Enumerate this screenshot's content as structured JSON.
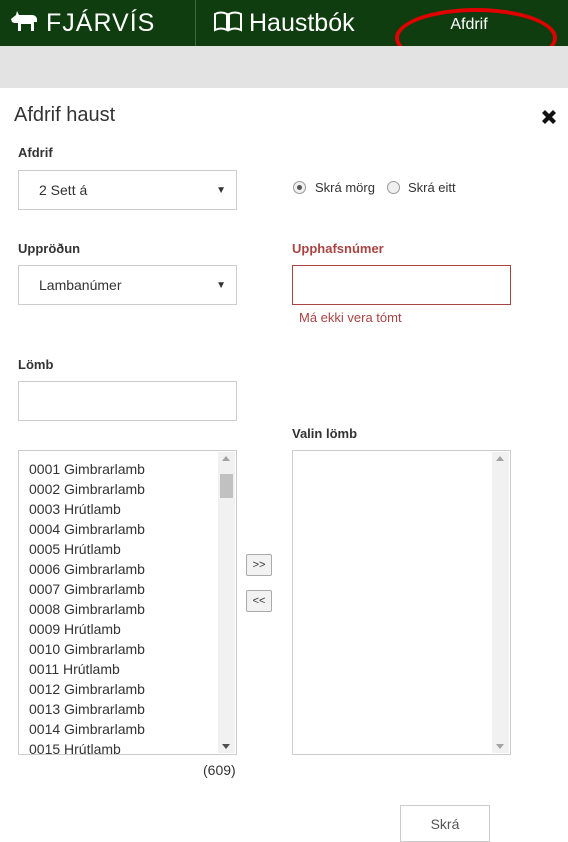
{
  "header": {
    "brand": "FJÁRVÍS",
    "book": "Haustbók",
    "active_tab": "Afdrif"
  },
  "modal": {
    "title": "Afdrif haust",
    "afdrif_label": "Afdrif",
    "afdrif_value": "2 Sett á",
    "radio_many": "Skrá mörg",
    "radio_one": "Skrá eitt",
    "sort_label": "Uppröðun",
    "sort_value": "Lambanúmer",
    "start_label": "Upphafsnúmer",
    "start_value": "",
    "start_error": "Má ekki vera tómt",
    "lambs_label": "Lömb",
    "lambs_filter_value": "",
    "selected_label": "Valin lömb",
    "lambs": [
      "0001 Gimbrarlamb",
      "0002 Gimbrarlamb",
      "0003 Hrútlamb",
      "0004 Gimbrarlamb",
      "0005 Hrútlamb",
      "0006 Gimbrarlamb",
      "0007 Gimbrarlamb",
      "0008 Gimbrarlamb",
      "0009 Hrútlamb",
      "0010 Gimbrarlamb",
      "0011 Hrútlamb",
      "0012 Gimbrarlamb",
      "0013 Gimbrarlamb",
      "0014 Gimbrarlamb",
      "0015 Hrútlamb"
    ],
    "count": "(609)",
    "add_button": ">>",
    "remove_button": "<<",
    "submit": "Skrá"
  },
  "colors": {
    "header_bg": "#0f3d0f",
    "error": "#a94442",
    "annotation": "#e00000"
  }
}
